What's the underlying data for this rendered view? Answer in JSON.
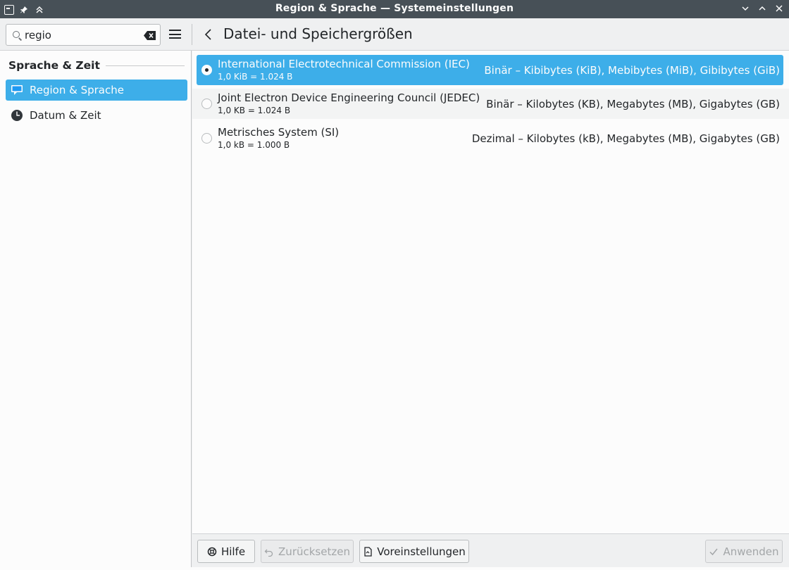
{
  "window": {
    "title": "Region & Sprache — Systemeinstellungen"
  },
  "search": {
    "value": "regio"
  },
  "header": {
    "page_title": "Datei- und Speichergrößen"
  },
  "sidebar": {
    "section_label": "Sprache & Zeit",
    "items": [
      {
        "label": "Region & Sprache",
        "icon": "region-language-icon",
        "active": true
      },
      {
        "label": "Datum & Zeit",
        "icon": "clock-icon",
        "active": false
      }
    ]
  },
  "options": [
    {
      "name": "International Electrotechnical Commission (IEC)",
      "example": "1,0 KiB = 1.024 B",
      "description": "Binär – Kibibytes (KiB), Mebibytes (MiB), Gibibytes (GiB)",
      "selected": true
    },
    {
      "name": "Joint Electron Device Engineering Council (JEDEC)",
      "example": "1,0 KB = 1.024 B",
      "description": "Binär – Kilobytes (KB), Megabytes (MB), Gigabytes (GB)",
      "selected": false
    },
    {
      "name": "Metrisches System (SI)",
      "example": "1,0 kB = 1.000 B",
      "description": "Dezimal – Kilobytes (kB), Megabytes (MB), Gigabytes (GB)",
      "selected": false
    }
  ],
  "footer": {
    "help_label": "Hilfe",
    "reset_label": "Zurücksetzen",
    "defaults_label": "Voreinstellungen",
    "apply_label": "Anwenden"
  },
  "colors": {
    "accent": "#3daee9",
    "titlebar": "#475057",
    "window_bg": "#eff0f1",
    "view_bg": "#fcfcfc"
  }
}
